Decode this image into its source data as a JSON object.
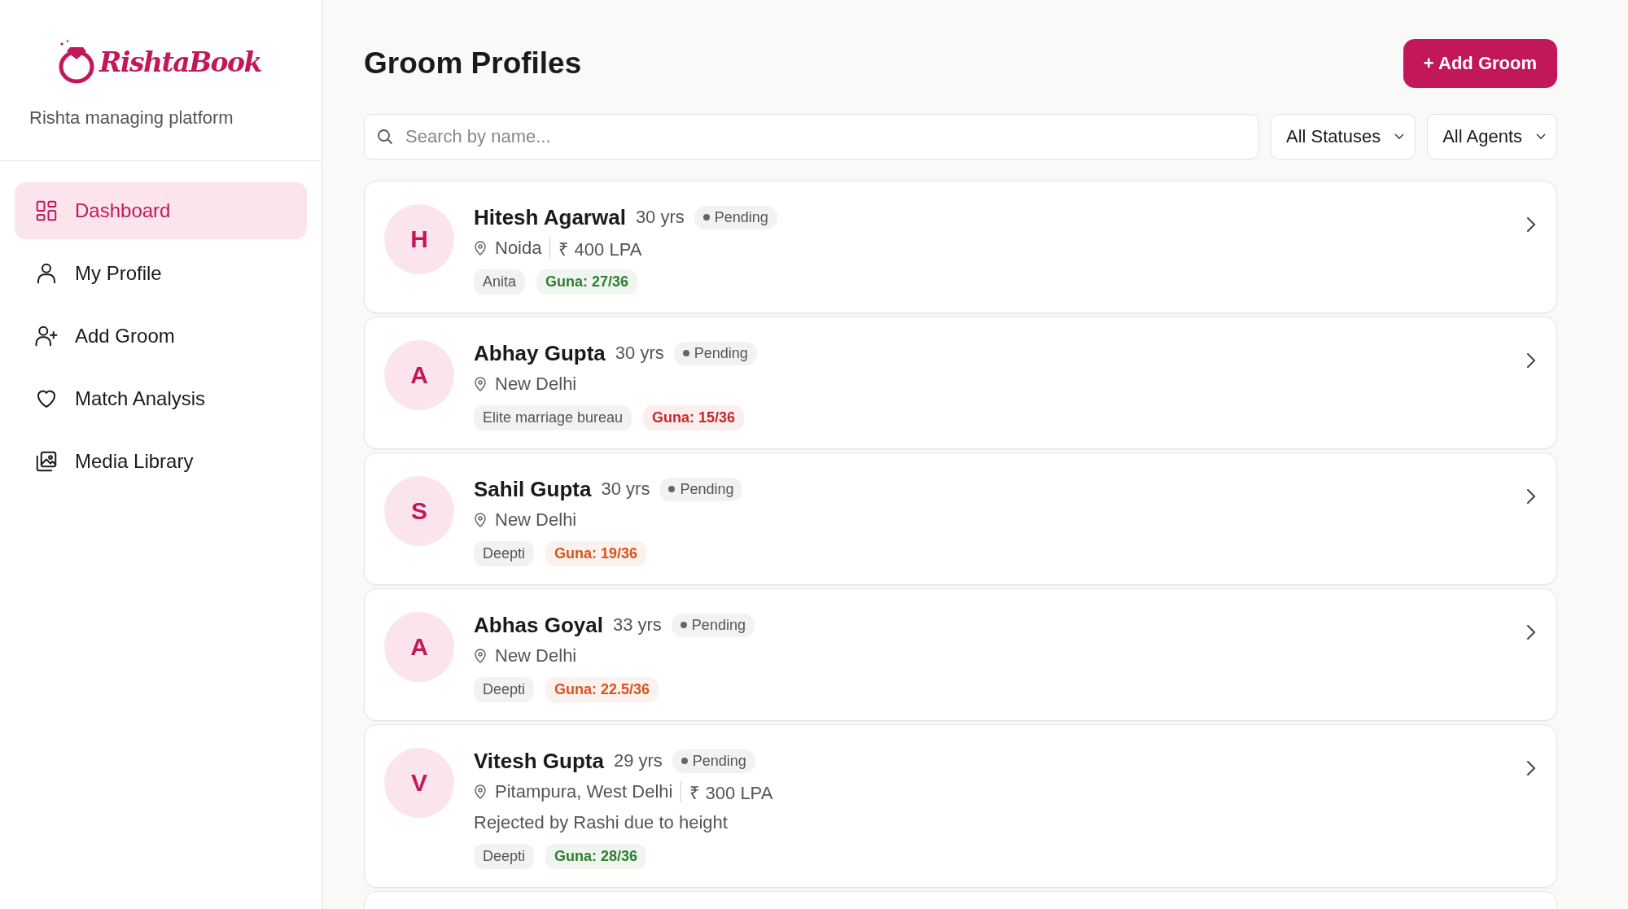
{
  "sidebar": {
    "logo": "RishtaBook",
    "tagline": "Rishta managing platform",
    "items": [
      {
        "label": "Dashboard",
        "selected": true
      },
      {
        "label": "My Profile",
        "selected": false
      },
      {
        "label": "Add Groom",
        "selected": false
      },
      {
        "label": "Match Analysis",
        "selected": false
      },
      {
        "label": "Media Library",
        "selected": false
      }
    ]
  },
  "header": {
    "title": "Groom Profiles",
    "add_button": "+ Add Groom"
  },
  "filters": {
    "search": {
      "placeholder": "Search by name..."
    },
    "status": "All Statuses",
    "agent": "All Agents"
  },
  "profiles": [
    {
      "initial": "H",
      "name": "Hitesh Agarwal",
      "age": "30 yrs",
      "status": "Pending",
      "location": "Noida",
      "salary": "₹ 400 LPA",
      "agent": "Anita",
      "guna": {
        "text": "Guna: 27/36",
        "color": "#2e7d32"
      }
    },
    {
      "initial": "A",
      "name": "Abhay Gupta",
      "age": "30 yrs",
      "status": "Pending",
      "location": "New Delhi",
      "agent": "Elite marriage bureau",
      "guna": {
        "text": "Guna: 15/36",
        "color": "#c62828"
      }
    },
    {
      "initial": "S",
      "name": "Sahil Gupta",
      "age": "30 yrs",
      "status": "Pending",
      "location": "New Delhi",
      "agent": "Deepti",
      "guna": {
        "text": "Guna: 19/36",
        "color": "#d9531e"
      }
    },
    {
      "initial": "A",
      "name": "Abhas Goyal",
      "age": "33 yrs",
      "status": "Pending",
      "location": "New Delhi",
      "agent": "Deepti",
      "guna": {
        "text": "Guna: 22.5/36",
        "color": "#d9531e"
      }
    },
    {
      "initial": "V",
      "name": "Vitesh Gupta",
      "age": "29 yrs",
      "status": "Pending",
      "location": "Pitampura, West Delhi",
      "salary": "₹ 300 LPA",
      "note": "Rejected by Rashi due to height",
      "agent": "Deepti",
      "guna": {
        "text": "Guna: 28/36",
        "color": "#2e7d32"
      }
    }
  ]
}
